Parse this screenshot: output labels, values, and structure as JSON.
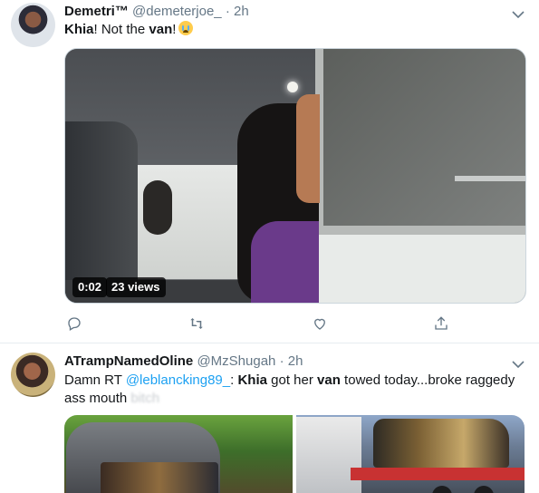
{
  "tweets": [
    {
      "author": {
        "name": "Demetri™",
        "handle": "@demeterjoe_",
        "separator": "·",
        "time": "2h"
      },
      "text": {
        "part1": "Khia",
        "part2": "! Not the ",
        "part3": "van",
        "part4": "!"
      },
      "emoji": "loudly-crying-face",
      "video": {
        "duration": "0:02",
        "views": "23 views"
      },
      "actions": [
        "reply-icon",
        "retweet-icon",
        "like-icon",
        "share-icon"
      ]
    },
    {
      "author": {
        "name": "ATrampNamedOline",
        "handle": "@MzShugah",
        "separator": "·",
        "time": "2h"
      },
      "text": {
        "part1": "Damn  RT ",
        "mention": "@leblancking89_",
        "part2": ": ",
        "bold1": "Khia",
        "part3": " got her ",
        "bold2": "van",
        "part4": " towed today...broke raggedy",
        "line2": "ass mouth ",
        "blurred": "bitch"
      },
      "media": [
        "tour-van-photo",
        "tow-truck-photo"
      ]
    }
  ],
  "colors": {
    "link": "#1da1f2",
    "muted": "#657786",
    "text": "#14171a",
    "border": "#e6ecf0"
  }
}
